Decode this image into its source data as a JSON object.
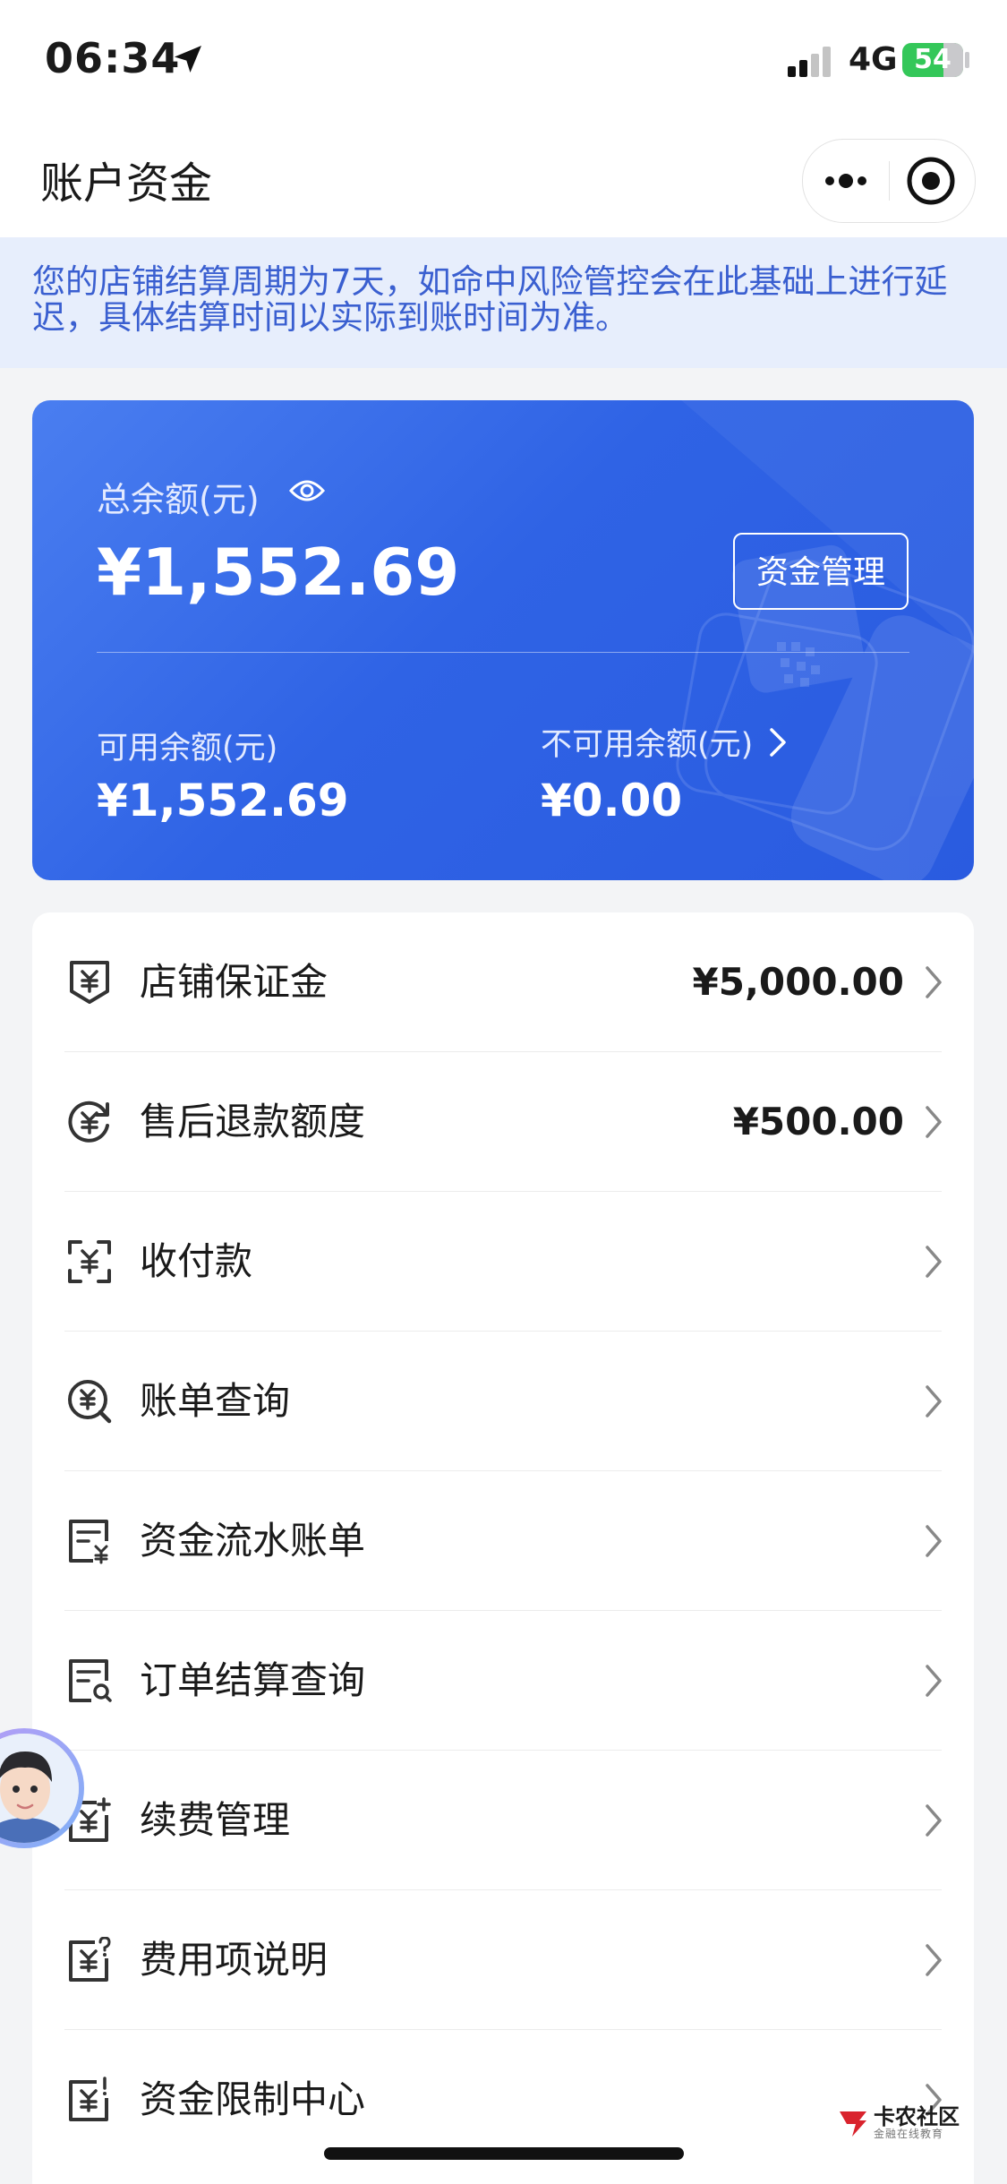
{
  "status_bar": {
    "time": "06:34",
    "network": "4G",
    "battery": "54"
  },
  "header": {
    "title": "账户资金"
  },
  "notice": {
    "text": "您的店铺结算周期为7天，如命中风险管控会在此基础上进行延迟，具体结算时间以实际到账时间为准。"
  },
  "balance": {
    "total_label": "总余额(元)",
    "total_amount": "¥1,552.69",
    "manage_button": "资金管理",
    "available_label": "可用余额(元)",
    "available_amount": "¥1,552.69",
    "unavailable_label": "不可用余额(元)",
    "unavailable_amount": "¥0.00"
  },
  "menu": [
    {
      "label": "店铺保证金",
      "value": "¥5,000.00",
      "icon": "shield-yuan-icon"
    },
    {
      "label": "售后退款额度",
      "value": "¥500.00",
      "icon": "refund-yuan-icon"
    },
    {
      "label": "收付款",
      "value": "",
      "icon": "scan-yuan-icon"
    },
    {
      "label": "账单查询",
      "value": "",
      "icon": "search-yuan-icon"
    },
    {
      "label": "资金流水账单",
      "value": "",
      "icon": "statement-yuan-icon"
    },
    {
      "label": "订单结算查询",
      "value": "",
      "icon": "order-search-icon"
    },
    {
      "label": "续费管理",
      "value": "",
      "icon": "renewal-icon"
    },
    {
      "label": "费用项说明",
      "value": "",
      "icon": "fee-question-icon"
    },
    {
      "label": "资金限制中心",
      "value": "",
      "icon": "fund-limit-icon"
    }
  ],
  "watermark": {
    "title": "卡农社区",
    "subtitle": "金融在线教育"
  },
  "colors": {
    "accent": "#2f63e5",
    "notice_text": "#3a5fd0",
    "notice_bg": "#e7eefc"
  }
}
